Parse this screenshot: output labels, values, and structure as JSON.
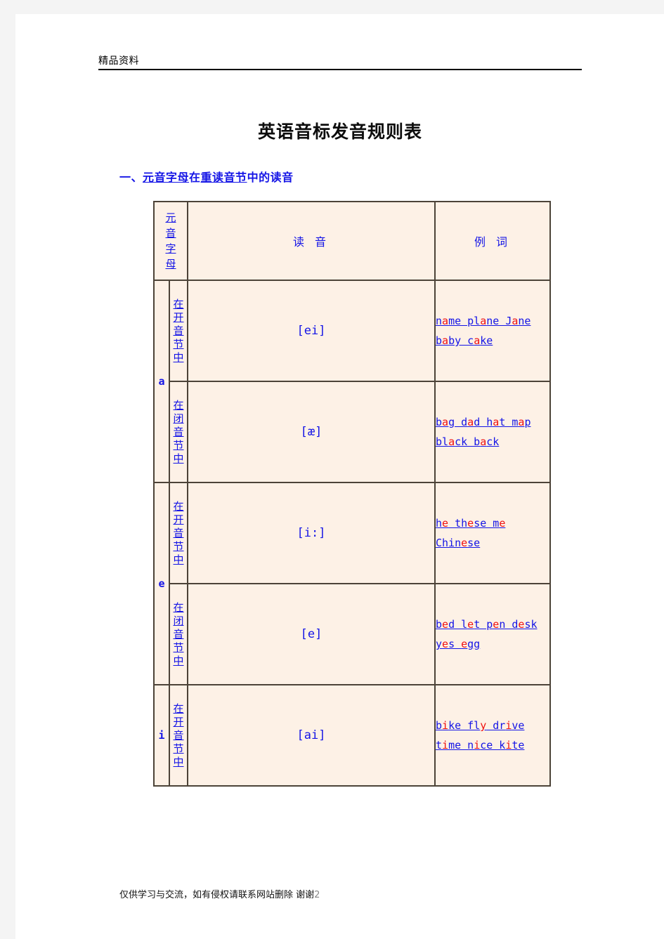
{
  "page": {
    "running_header": "精品资料",
    "title": "英语音标发音规则表",
    "footer_text": "仅供学习与交流，如有侵权请联系网站删除 谢谢",
    "footer_page_number": "2"
  },
  "section": {
    "number": "一、",
    "part_underlined_1": "元音字母",
    "part_plain_1": "在",
    "part_underlined_2": "重读音节",
    "part_plain_2": "中的读音"
  },
  "colors": {
    "blue_text": "#1414E6",
    "red_vowel": "#EE1111",
    "cell_background": "#FDF1E6",
    "border": "#4C4338",
    "title_black": "#0D0D0D"
  },
  "table": {
    "headers": {
      "letter": "元音字母",
      "sound": "读 音",
      "example": "例 词"
    },
    "rows": [
      {
        "letter": "a",
        "letter_rowspan": 2,
        "position": "在开音节中",
        "sound": "[ei]",
        "example_lines": [
          [
            {
              "t": "n",
              "v": false
            },
            {
              "t": "a",
              "v": true
            },
            {
              "t": "me pl",
              "v": false
            },
            {
              "t": "a",
              "v": true
            },
            {
              "t": "ne J",
              "v": false
            },
            {
              "t": "a",
              "v": true
            },
            {
              "t": "ne",
              "v": false
            }
          ],
          [
            {
              "t": "b",
              "v": false
            },
            {
              "t": "a",
              "v": true
            },
            {
              "t": "by c",
              "v": false
            },
            {
              "t": "a",
              "v": true
            },
            {
              "t": "ke",
              "v": false
            }
          ]
        ]
      },
      {
        "letter": null,
        "position": "在闭音节中",
        "sound": "[æ]",
        "example_lines": [
          [
            {
              "t": "b",
              "v": false
            },
            {
              "t": "a",
              "v": true
            },
            {
              "t": "g d",
              "v": false
            },
            {
              "t": "a",
              "v": true
            },
            {
              "t": "d h",
              "v": false
            },
            {
              "t": "a",
              "v": true
            },
            {
              "t": "t m",
              "v": false
            },
            {
              "t": "a",
              "v": true
            },
            {
              "t": "p",
              "v": false
            }
          ],
          [
            {
              "t": "bl",
              "v": false
            },
            {
              "t": "a",
              "v": true
            },
            {
              "t": "ck b",
              "v": false
            },
            {
              "t": "a",
              "v": true
            },
            {
              "t": "ck",
              "v": false
            }
          ]
        ]
      },
      {
        "letter": "e",
        "letter_rowspan": 2,
        "position": "在开音节中",
        "sound": "[i:]",
        "example_lines": [
          [
            {
              "t": "h",
              "v": false
            },
            {
              "t": "e",
              "v": true
            },
            {
              "t": " th",
              "v": false
            },
            {
              "t": "e",
              "v": true
            },
            {
              "t": "se m",
              "v": false
            },
            {
              "t": "e",
              "v": true
            }
          ],
          [
            {
              "t": "Chin",
              "v": false
            },
            {
              "t": "e",
              "v": true
            },
            {
              "t": "se",
              "v": false
            }
          ]
        ]
      },
      {
        "letter": null,
        "position": "在闭音节中",
        "sound": "[e]",
        "example_lines": [
          [
            {
              "t": "b",
              "v": false
            },
            {
              "t": "e",
              "v": true
            },
            {
              "t": "d l",
              "v": false
            },
            {
              "t": "e",
              "v": true
            },
            {
              "t": "t p",
              "v": false
            },
            {
              "t": "e",
              "v": true
            },
            {
              "t": "n d",
              "v": false
            },
            {
              "t": "e",
              "v": true
            },
            {
              "t": "sk",
              "v": false
            }
          ],
          [
            {
              "t": "y",
              "v": false
            },
            {
              "t": "e",
              "v": true
            },
            {
              "t": "s ",
              "v": false
            },
            {
              "t": "e",
              "v": true
            },
            {
              "t": "gg",
              "v": false
            }
          ]
        ]
      },
      {
        "letter": "i",
        "letter_rowspan": 1,
        "position": "在开音节中",
        "sound": "[ai]",
        "example_lines": [
          [
            {
              "t": "b",
              "v": false
            },
            {
              "t": "i",
              "v": true
            },
            {
              "t": "ke fl",
              "v": false
            },
            {
              "t": "y",
              "v": true
            },
            {
              "t": " dr",
              "v": false
            },
            {
              "t": "i",
              "v": true
            },
            {
              "t": "ve",
              "v": false
            }
          ],
          [
            {
              "t": "t",
              "v": false
            },
            {
              "t": "i",
              "v": true
            },
            {
              "t": "me n",
              "v": false
            },
            {
              "t": "i",
              "v": true
            },
            {
              "t": "ce k",
              "v": false
            },
            {
              "t": "i",
              "v": true
            },
            {
              "t": "te",
              "v": false
            }
          ]
        ]
      }
    ]
  }
}
